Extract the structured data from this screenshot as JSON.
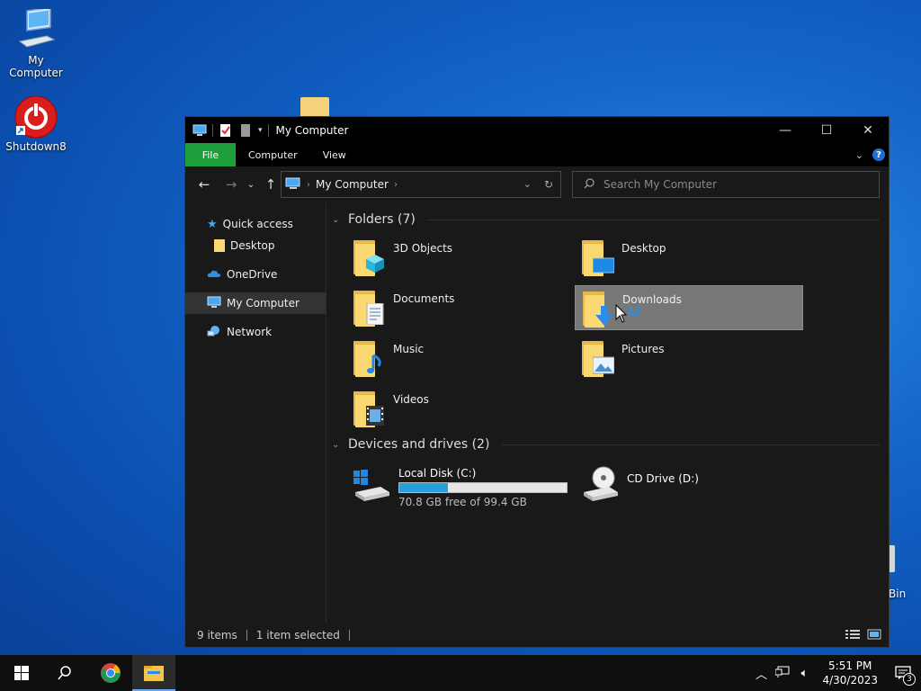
{
  "desktop": {
    "icons": [
      {
        "label": "My Computer",
        "icon": "computer-icon"
      },
      {
        "label": "Shutdown8",
        "icon": "power-icon"
      }
    ],
    "recycle_label": "Bin"
  },
  "window": {
    "title": "My Computer",
    "ribbon_tabs": [
      "File",
      "Computer",
      "View"
    ],
    "address": {
      "crumb": "My Computer"
    },
    "search_placeholder": "Search My Computer",
    "nav": {
      "quick_access": "Quick access",
      "desktop": "Desktop",
      "onedrive": "OneDrive",
      "my_computer": "My Computer",
      "network": "Network"
    },
    "folders_header": "Folders (7)",
    "folders": [
      {
        "label": "3D Objects",
        "icon": "3d-objects-icon"
      },
      {
        "label": "Desktop",
        "icon": "desktop-folder-icon"
      },
      {
        "label": "Documents",
        "icon": "documents-icon"
      },
      {
        "label": "Downloads",
        "icon": "downloads-icon",
        "selected": true
      },
      {
        "label": "Music",
        "icon": "music-icon"
      },
      {
        "label": "Pictures",
        "icon": "pictures-icon"
      },
      {
        "label": "Videos",
        "icon": "videos-icon"
      }
    ],
    "drives_header": "Devices and drives (2)",
    "drives": [
      {
        "label": "Local Disk (C:)",
        "free_text": "70.8 GB free of 99.4 GB",
        "used_fraction": 0.29
      },
      {
        "label": "CD Drive (D:)"
      }
    ],
    "status": {
      "items": "9 items",
      "selected": "1 item selected"
    }
  },
  "taskbar": {
    "time": "5:51 PM",
    "date": "4/30/2023",
    "notifications": "3"
  },
  "colors": {
    "accent_green": "#1e9e3c",
    "drive_bar": "#26a0da"
  }
}
